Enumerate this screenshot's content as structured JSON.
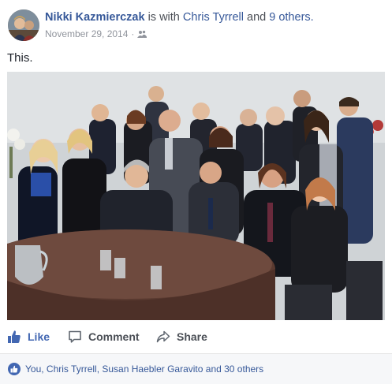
{
  "post": {
    "author": "Nikki Kazmierczak",
    "with_text": "is with",
    "tagged_person": "Chris Tyrrell",
    "and_text": "and",
    "others": "9 others.",
    "date": "November 29, 2014",
    "dot": "·",
    "audience_icon": "friends-icon",
    "text": "This."
  },
  "actions": {
    "like": "Like",
    "comment": "Comment",
    "share": "Share"
  },
  "likes": {
    "summary": "You, Chris Tyrrell, Susan Haebler Garavito and 30 others"
  },
  "colors": {
    "link": "#365899",
    "like_blue": "#4267b2",
    "meta_gray": "#90949c",
    "likes_bg": "#f6f7f9"
  }
}
